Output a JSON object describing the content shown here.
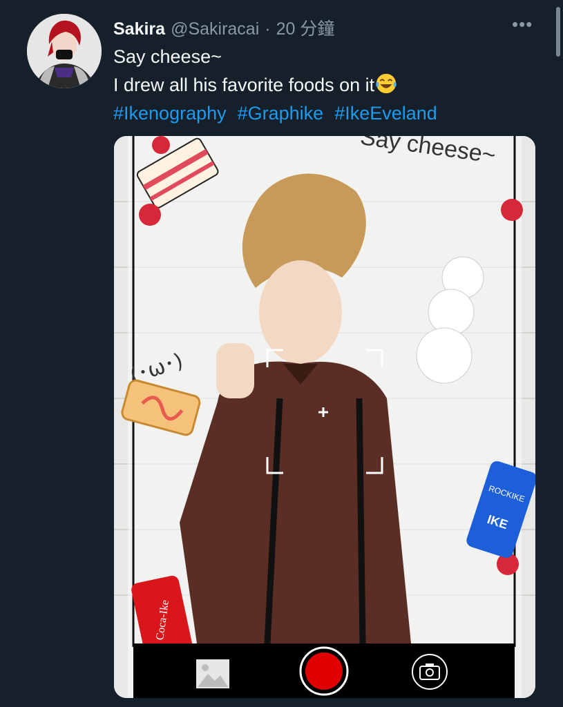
{
  "tweet": {
    "display_name": "Sakira",
    "handle": "@Sakiracai",
    "separator": "·",
    "timestamp": "20 分鐘",
    "text_line1": "Say cheese~",
    "text_line2": "I drew all his favorite foods on it",
    "hashtags": [
      "#Ikenography",
      "#Graphike",
      "#IkeEveland"
    ]
  },
  "artwork": {
    "caption": "Say cheese~",
    "kaomoji": "(･ω･)",
    "can_blue_text": "ROCKIKE",
    "can_blue_label": "IKE",
    "can_red_text": "Coca-Ike"
  },
  "icons": {
    "more": "more-horizontal-icon",
    "gallery": "gallery-icon",
    "shutter": "shutter-icon",
    "switch_camera": "camera-switch-icon",
    "laugh_emoji": "laughing-emoji-icon"
  },
  "colors": {
    "background": "#15202b",
    "link": "#1d9bf0",
    "secondary_text": "#8b98a5",
    "shutter_red": "#e00000"
  }
}
